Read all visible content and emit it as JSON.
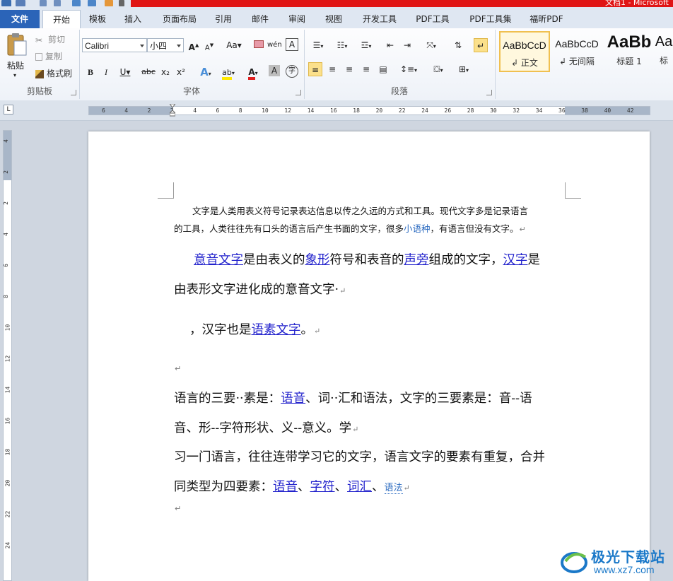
{
  "window": {
    "title": "文档1 - Microsoft"
  },
  "tabs": [
    "文件",
    "开始",
    "模板",
    "插入",
    "页面布局",
    "引用",
    "邮件",
    "审阅",
    "视图",
    "开发工具",
    "PDF工具",
    "PDF工具集",
    "福昕PDF"
  ],
  "clipboard": {
    "paste": "粘贴",
    "cut": "剪切",
    "copy": "复制",
    "format_painter": "格式刷",
    "label": "剪贴板"
  },
  "font": {
    "name": "Calibri",
    "size": "小四",
    "label": "字体",
    "grow": "A",
    "shrink": "A",
    "case": "Aa",
    "bold": "B",
    "italic": "I",
    "underline": "U",
    "strike": "abc",
    "subscript": "x₂",
    "superscript": "x²",
    "effects": "A",
    "highlight": "ab",
    "color": "A",
    "shade": "A",
    "enclose": "字",
    "phonetic": "wén",
    "border": "A"
  },
  "paragraph": {
    "label": "段落"
  },
  "styles": [
    {
      "sample": "AaBbCcD",
      "name": "正文"
    },
    {
      "sample": "AaBbCcD",
      "name": "无间隔"
    },
    {
      "sample": "AaBb",
      "name": "标题 1"
    },
    {
      "sample": "Aa",
      "name": "标"
    }
  ],
  "ruler": {
    "h_marks": [
      "6",
      "4",
      "2",
      "2",
      "4",
      "6",
      "8",
      "10",
      "12",
      "14",
      "16",
      "18",
      "20",
      "22",
      "24",
      "26",
      "28",
      "30",
      "32",
      "34",
      "36",
      "38",
      "40",
      "42"
    ],
    "v_marks": [
      "4",
      "2",
      "2",
      "4",
      "6",
      "8",
      "10",
      "12",
      "14",
      "16",
      "18",
      "20",
      "22",
      "24"
    ]
  },
  "document": {
    "p1_line1": "文字是人类用表义符号记录表达信息以传之久远的方式和工具。现代文字多是记录语言",
    "p1_line2a": "的工具，人类往往先有口头的语言后产生书面的文字，很多",
    "p1_line2_link": "小语种",
    "p1_line2b": "，有语言但没有文字。",
    "p2_link1": "意音文字",
    "p2_t1": "是由表义的",
    "p2_link2": "象形",
    "p2_t2": "符号和表音的",
    "p2_link3": "声旁",
    "p2_t3": "组成的文字，",
    "p2_link4": "汉字",
    "p2_t4": "是",
    "p2_line2": "由表形文字进化成的意音文字·",
    "p3_t1": "，汉字也是",
    "p3_link": "语素文字",
    "p3_t2": "。",
    "p5_t1": "语言的三要··素是：",
    "p5_link1": "语音",
    "p5_t2": "、词··汇和语法，文字的三要素是：音--语",
    "p5_line2": "音、形--字符形状、义--意义。学",
    "p6_line1": "习一门语言，往往连带学习它的文字，语言文字的要素有重复，合并",
    "p6_t1": "同类型为四要素：",
    "p6_link1": "语音",
    "p6_sep1": "、",
    "p6_link2": "字符",
    "p6_sep2": "、",
    "p6_link3": "词汇",
    "p6_sep3": "、",
    "p6_link4": "语法",
    "para_mark": "↵"
  },
  "watermark": {
    "brand": "极光下载站",
    "url": "www.xz7.com"
  },
  "colors": {
    "file_tab": "#2b64b8",
    "title_red": "#e01515",
    "link": "#2222cc"
  }
}
